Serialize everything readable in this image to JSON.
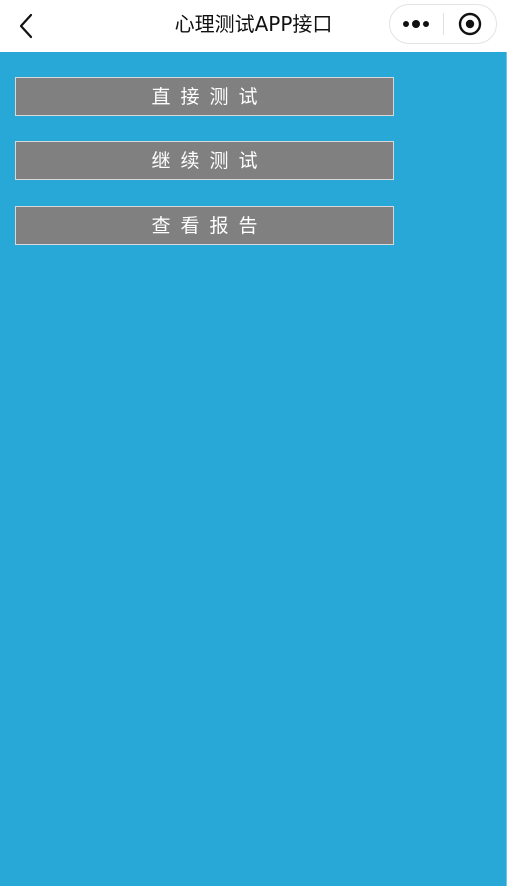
{
  "header": {
    "title": "心理测试APP接口",
    "back_icon": "chevron-left-icon",
    "more_icon": "more-dots-icon",
    "close_icon": "target-close-icon"
  },
  "menu": {
    "buttons": [
      {
        "label": "直接测试"
      },
      {
        "label": "继续测试"
      },
      {
        "label": "查看报告"
      }
    ]
  },
  "colors": {
    "background": "#27a8d6",
    "button_bg": "#808080",
    "button_border": "#d8d8d8",
    "button_text": "#ffffff",
    "nav_bg": "#ffffff",
    "title_text": "#111111"
  }
}
